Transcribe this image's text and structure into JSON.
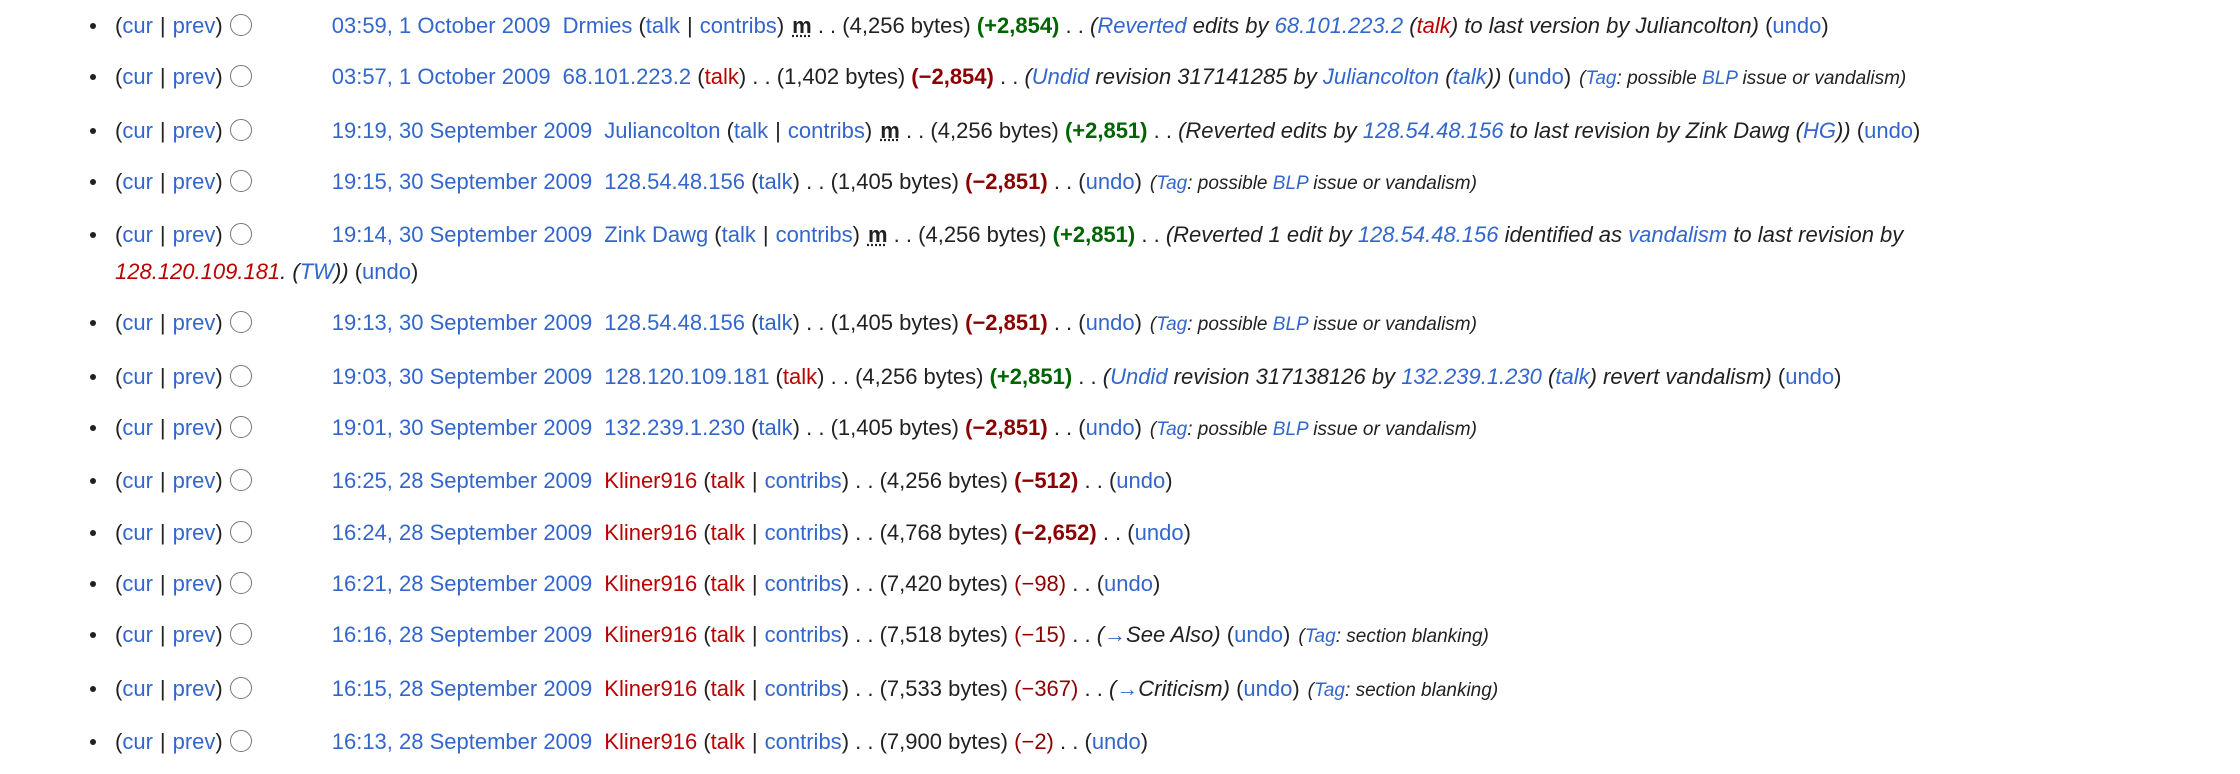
{
  "labels": {
    "cur": "cur",
    "prev": "prev",
    "talk": "talk",
    "contribs": "contribs",
    "undo": "undo",
    "minor": "m",
    "dots": ". .",
    "tag": "Tag",
    "pipe": "|"
  },
  "rows": [
    {
      "date": "03:59, 1 October 2009",
      "user": "Drmies",
      "user_red": false,
      "talk_red": false,
      "contribs": true,
      "minor": true,
      "bytes": "(4,256 bytes)",
      "diff": "(+2,854)",
      "diff_type": "pos",
      "comment": [
        {
          "t": "("
        },
        {
          "t": "Reverted",
          "link": true
        },
        {
          "t": " edits by "
        },
        {
          "t": "68.101.223.2",
          "link": true
        },
        {
          "t": " ("
        },
        {
          "t": "talk",
          "link": true,
          "red": true
        },
        {
          "t": ") to last version by Juliancolton)"
        }
      ],
      "undo": true,
      "tag": null
    },
    {
      "date": "03:57, 1 October 2009",
      "user": "68.101.223.2",
      "user_red": false,
      "talk_red": true,
      "contribs": false,
      "minor": false,
      "bytes": "(1,402 bytes)",
      "diff": "(−2,854)",
      "diff_type": "neg",
      "comment": [
        {
          "t": "("
        },
        {
          "t": "Undid",
          "link": true
        },
        {
          "t": " revision 317141285 by "
        },
        {
          "t": "Juliancolton",
          "link": true
        },
        {
          "t": " ("
        },
        {
          "t": "talk",
          "link": true
        },
        {
          "t": "))"
        }
      ],
      "undo": true,
      "tag": [
        {
          "t": "possible "
        },
        {
          "t": "BLP",
          "link": true
        },
        {
          "t": " issue or vandalism"
        }
      ]
    },
    {
      "date": "19:19, 30 September 2009",
      "user": "Juliancolton",
      "user_red": false,
      "talk_red": false,
      "contribs": true,
      "minor": true,
      "bytes": "(4,256 bytes)",
      "diff": "(+2,851)",
      "diff_type": "pos",
      "comment": [
        {
          "t": "(Reverted edits by "
        },
        {
          "t": "128.54.48.156",
          "link": true
        },
        {
          "t": " to last revision by Zink Dawg ("
        },
        {
          "t": "HG",
          "link": true
        },
        {
          "t": "))"
        }
      ],
      "undo": true,
      "tag": null
    },
    {
      "date": "19:15, 30 September 2009",
      "user": "128.54.48.156",
      "user_red": false,
      "talk_red": false,
      "contribs": false,
      "minor": false,
      "bytes": "(1,405 bytes)",
      "diff": "(−2,851)",
      "diff_type": "neg",
      "comment": [],
      "undo": true,
      "tag": [
        {
          "t": "possible "
        },
        {
          "t": "BLP",
          "link": true
        },
        {
          "t": " issue or vandalism"
        }
      ]
    },
    {
      "date": "19:14, 30 September 2009",
      "user": "Zink Dawg",
      "user_red": false,
      "talk_red": false,
      "contribs": true,
      "minor": true,
      "bytes": "(4,256 bytes)",
      "diff": "(+2,851)",
      "diff_type": "pos",
      "comment": [
        {
          "t": "(Reverted 1 edit by "
        },
        {
          "t": "128.54.48.156",
          "link": true
        },
        {
          "t": " identified as "
        },
        {
          "t": "vandalism",
          "link": true
        },
        {
          "t": " to last revision by "
        },
        {
          "t": "128.120.109.181",
          "link": true,
          "red": true
        },
        {
          "t": ". ("
        },
        {
          "t": "TW",
          "link": true
        },
        {
          "t": "))"
        }
      ],
      "undo": true,
      "tag": null
    },
    {
      "date": "19:13, 30 September 2009",
      "user": "128.54.48.156",
      "user_red": false,
      "talk_red": false,
      "contribs": false,
      "minor": false,
      "bytes": "(1,405 bytes)",
      "diff": "(−2,851)",
      "diff_type": "neg",
      "comment": [],
      "undo": true,
      "tag": [
        {
          "t": "possible "
        },
        {
          "t": "BLP",
          "link": true
        },
        {
          "t": " issue or vandalism"
        }
      ]
    },
    {
      "date": "19:03, 30 September 2009",
      "user": "128.120.109.181",
      "user_red": false,
      "talk_red": true,
      "contribs": false,
      "minor": false,
      "bytes": "(4,256 bytes)",
      "diff": "(+2,851)",
      "diff_type": "pos",
      "comment": [
        {
          "t": "("
        },
        {
          "t": "Undid",
          "link": true
        },
        {
          "t": " revision 317138126 by "
        },
        {
          "t": "132.239.1.230",
          "link": true
        },
        {
          "t": " ("
        },
        {
          "t": "talk",
          "link": true
        },
        {
          "t": ") revert vandalism)"
        }
      ],
      "undo": true,
      "tag": null
    },
    {
      "date": "19:01, 30 September 2009",
      "user": "132.239.1.230",
      "user_red": false,
      "talk_red": false,
      "contribs": false,
      "minor": false,
      "bytes": "(1,405 bytes)",
      "diff": "(−2,851)",
      "diff_type": "neg",
      "comment": [],
      "undo": true,
      "tag": [
        {
          "t": "possible "
        },
        {
          "t": "BLP",
          "link": true
        },
        {
          "t": " issue or vandalism"
        }
      ]
    },
    {
      "date": "16:25, 28 September 2009",
      "user": "Kliner916",
      "user_red": true,
      "talk_red": true,
      "contribs": true,
      "minor": false,
      "bytes": "(4,256 bytes)",
      "diff": "(−512)",
      "diff_type": "neg",
      "comment": [],
      "undo": true,
      "tag": null
    },
    {
      "date": "16:24, 28 September 2009",
      "user": "Kliner916",
      "user_red": true,
      "talk_red": true,
      "contribs": true,
      "minor": false,
      "bytes": "(4,768 bytes)",
      "diff": "(−2,652)",
      "diff_type": "neg",
      "comment": [],
      "undo": true,
      "tag": null
    },
    {
      "date": "16:21, 28 September 2009",
      "user": "Kliner916",
      "user_red": true,
      "talk_red": true,
      "contribs": true,
      "minor": false,
      "bytes": "(7,420 bytes)",
      "diff": "(−98)",
      "diff_type": "neg-s",
      "comment": [],
      "undo": true,
      "tag": null
    },
    {
      "date": "16:16, 28 September 2009",
      "user": "Kliner916",
      "user_red": true,
      "talk_red": true,
      "contribs": true,
      "minor": false,
      "bytes": "(7,518 bytes)",
      "diff": "(−15)",
      "diff_type": "neg-s",
      "comment": [
        {
          "t": "("
        },
        {
          "t": "→",
          "link": true
        },
        {
          "t": "See Also)"
        }
      ],
      "undo": true,
      "tag": [
        {
          "t": "section blanking"
        }
      ]
    },
    {
      "date": "16:15, 28 September 2009",
      "user": "Kliner916",
      "user_red": true,
      "talk_red": true,
      "contribs": true,
      "minor": false,
      "bytes": "(7,533 bytes)",
      "diff": "(−367)",
      "diff_type": "neg-s",
      "comment": [
        {
          "t": "("
        },
        {
          "t": "→",
          "link": true
        },
        {
          "t": "Criticism)"
        }
      ],
      "undo": true,
      "tag": [
        {
          "t": "section blanking"
        }
      ]
    },
    {
      "date": "16:13, 28 September 2009",
      "user": "Kliner916",
      "user_red": true,
      "talk_red": true,
      "contribs": true,
      "minor": false,
      "bytes": "(7,900 bytes)",
      "diff": "(−2)",
      "diff_type": "neg-s",
      "comment": [],
      "undo": true,
      "tag": null
    }
  ]
}
